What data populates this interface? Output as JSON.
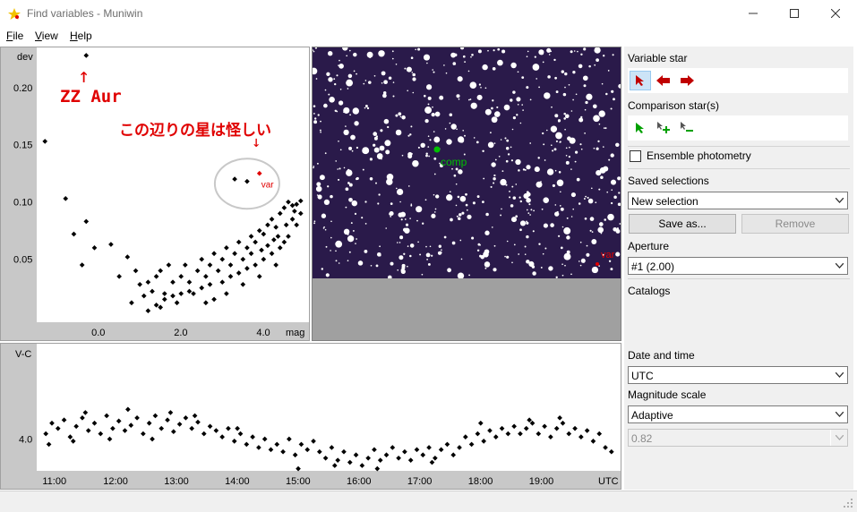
{
  "window": {
    "title": "Find variables - Muniwin"
  },
  "menu": {
    "file": {
      "accel": "F",
      "rest": "ile"
    },
    "view": {
      "accel": "V",
      "rest": "iew"
    },
    "help": {
      "accel": "H",
      "rest": "elp"
    }
  },
  "annotations": {
    "zz_arrow": "↑",
    "zz_aur": "ZZ Aur",
    "suspicious": "この辺りの星は怪しい",
    "down_arrow": "↓"
  },
  "image": {
    "comp_label": "comp",
    "var_label": "var"
  },
  "right_panel": {
    "variable_star": "Variable star",
    "comparison_stars": "Comparison star(s)",
    "ensemble": "Ensemble photometry",
    "saved_selections": "Saved selections",
    "selection_value": "New selection",
    "save_as": "Save as...",
    "remove": "Remove",
    "aperture": "Aperture",
    "aperture_value": "#1 (2.00)",
    "catalogs": "Catalogs",
    "date_time": "Date and time",
    "date_time_value": "UTC",
    "mag_scale": "Magnitude scale",
    "mag_scale_value": "Adaptive",
    "mag_range_value": "0.82"
  },
  "colors": {
    "accent": "#cce4f7",
    "annotation": "#e00000",
    "var_marker": "#e00000",
    "comp_marker": "#00c000",
    "starfield": "#2a1a4a"
  },
  "chart_data": [
    {
      "type": "scatter",
      "title": "",
      "xlabel": "mag",
      "ylabel": "dev",
      "xticks": [
        "0.0",
        "2.0",
        "4.0"
      ],
      "yticks": [
        "0.20",
        "0.15",
        "0.10",
        "0.05"
      ],
      "xlim": [
        -1.5,
        5.1
      ],
      "ylim": [
        -0.005,
        0.235
      ],
      "highlight": {
        "name": "var",
        "x": 3.9,
        "y": 0.125
      },
      "circle_annotation": {
        "cx": 3.6,
        "cy": 0.116
      },
      "points": [
        [
          -0.3,
          0.228
        ],
        [
          -1.3,
          0.153
        ],
        [
          -0.8,
          0.103
        ],
        [
          -0.3,
          0.083
        ],
        [
          -0.6,
          0.072
        ],
        [
          -0.1,
          0.06
        ],
        [
          0.3,
          0.063
        ],
        [
          0.7,
          0.052
        ],
        [
          -0.4,
          0.045
        ],
        [
          0.5,
          0.035
        ],
        [
          0.9,
          0.04
        ],
        [
          1.0,
          0.028
        ],
        [
          1.2,
          0.03
        ],
        [
          1.4,
          0.035
        ],
        [
          1.5,
          0.04
        ],
        [
          1.6,
          0.02
        ],
        [
          1.7,
          0.045
        ],
        [
          1.8,
          0.03
        ],
        [
          1.9,
          0.012
        ],
        [
          2.0,
          0.035
        ],
        [
          2.1,
          0.045
        ],
        [
          2.2,
          0.03
        ],
        [
          2.3,
          0.02
        ],
        [
          2.4,
          0.04
        ],
        [
          2.5,
          0.05
        ],
        [
          2.6,
          0.035
        ],
        [
          2.7,
          0.045
        ],
        [
          2.8,
          0.055
        ],
        [
          2.9,
          0.04
        ],
        [
          3.0,
          0.05
        ],
        [
          3.1,
          0.06
        ],
        [
          3.2,
          0.045
        ],
        [
          3.3,
          0.055
        ],
        [
          3.4,
          0.065
        ],
        [
          3.5,
          0.05
        ],
        [
          3.6,
          0.06
        ],
        [
          3.7,
          0.07
        ],
        [
          3.8,
          0.065
        ],
        [
          3.9,
          0.075
        ],
        [
          4.0,
          0.072
        ],
        [
          4.1,
          0.08
        ],
        [
          4.2,
          0.085
        ],
        [
          4.3,
          0.078
        ],
        [
          4.4,
          0.09
        ],
        [
          4.5,
          0.095
        ],
        [
          4.6,
          0.1
        ],
        [
          4.7,
          0.097
        ],
        [
          4.8,
          0.098
        ],
        [
          4.9,
          0.101
        ],
        [
          1.1,
          0.018
        ],
        [
          1.3,
          0.022
        ],
        [
          1.6,
          0.015
        ],
        [
          1.8,
          0.018
        ],
        [
          2.0,
          0.02
        ],
        [
          2.2,
          0.022
        ],
        [
          2.5,
          0.025
        ],
        [
          2.7,
          0.028
        ],
        [
          3.0,
          0.03
        ],
        [
          3.2,
          0.035
        ],
        [
          3.4,
          0.038
        ],
        [
          3.6,
          0.042
        ],
        [
          3.8,
          0.045
        ],
        [
          4.0,
          0.05
        ],
        [
          4.2,
          0.055
        ],
        [
          4.4,
          0.06
        ],
        [
          4.6,
          0.07
        ],
        [
          4.8,
          0.08
        ],
        [
          1.2,
          0.005
        ],
        [
          1.5,
          0.008
        ],
        [
          2.8,
          0.015
        ],
        [
          3.1,
          0.02
        ],
        [
          3.5,
          0.028
        ],
        [
          3.9,
          0.035
        ],
        [
          4.3,
          0.045
        ],
        [
          4.5,
          0.065
        ],
        [
          4.7,
          0.085
        ],
        [
          4.9,
          0.09
        ],
        [
          3.3,
          0.12
        ],
        [
          3.6,
          0.118
        ],
        [
          0.8,
          0.012
        ],
        [
          1.4,
          0.01
        ],
        [
          2.6,
          0.012
        ],
        [
          3.7,
          0.055
        ],
        [
          4.1,
          0.062
        ],
        [
          4.35,
          0.07
        ],
        [
          4.55,
          0.08
        ],
        [
          4.75,
          0.092
        ],
        [
          4.25,
          0.067
        ],
        [
          3.95,
          0.058
        ]
      ]
    },
    {
      "type": "scatter",
      "title": "",
      "xlabel": "UTC",
      "ylabel": "V-C",
      "xticks": [
        "11:00",
        "12:00",
        "13:00",
        "14:00",
        "15:00",
        "16:00",
        "17:00",
        "18:00",
        "19:00"
      ],
      "yticks": [
        "4.0"
      ],
      "xlim": [
        10.7,
        20.3
      ],
      "ylim": [
        3.1,
        4.3
      ],
      "points": [
        [
          10.85,
          3.95
        ],
        [
          10.95,
          3.85
        ],
        [
          11.05,
          3.9
        ],
        [
          11.15,
          3.82
        ],
        [
          11.25,
          3.98
        ],
        [
          11.35,
          3.88
        ],
        [
          11.45,
          3.8
        ],
        [
          11.55,
          3.92
        ],
        [
          11.65,
          3.85
        ],
        [
          11.75,
          3.95
        ],
        [
          11.85,
          3.78
        ],
        [
          11.95,
          3.9
        ],
        [
          12.05,
          3.83
        ],
        [
          12.15,
          3.92
        ],
        [
          12.25,
          3.87
        ],
        [
          12.35,
          3.8
        ],
        [
          12.45,
          3.95
        ],
        [
          12.55,
          3.85
        ],
        [
          12.65,
          3.78
        ],
        [
          12.75,
          3.9
        ],
        [
          12.85,
          3.82
        ],
        [
          12.95,
          3.93
        ],
        [
          13.05,
          3.86
        ],
        [
          13.15,
          3.8
        ],
        [
          13.25,
          3.9
        ],
        [
          13.35,
          3.84
        ],
        [
          13.45,
          3.95
        ],
        [
          13.55,
          3.88
        ],
        [
          13.65,
          3.92
        ],
        [
          13.75,
          3.98
        ],
        [
          13.85,
          3.9
        ],
        [
          13.95,
          4.02
        ],
        [
          14.05,
          3.95
        ],
        [
          14.15,
          4.05
        ],
        [
          14.25,
          3.98
        ],
        [
          14.35,
          4.08
        ],
        [
          14.45,
          4.0
        ],
        [
          14.55,
          4.1
        ],
        [
          14.65,
          4.05
        ],
        [
          14.75,
          4.12
        ],
        [
          14.85,
          4.0
        ],
        [
          14.95,
          4.15
        ],
        [
          15.05,
          4.05
        ],
        [
          15.15,
          4.1
        ],
        [
          15.25,
          4.02
        ],
        [
          15.35,
          4.12
        ],
        [
          15.45,
          4.18
        ],
        [
          15.55,
          4.08
        ],
        [
          15.65,
          4.2
        ],
        [
          15.75,
          4.12
        ],
        [
          15.85,
          4.22
        ],
        [
          15.95,
          4.15
        ],
        [
          16.05,
          4.25
        ],
        [
          16.15,
          4.18
        ],
        [
          16.25,
          4.1
        ],
        [
          16.35,
          4.2
        ],
        [
          16.45,
          4.15
        ],
        [
          16.55,
          4.08
        ],
        [
          16.65,
          4.18
        ],
        [
          16.75,
          4.12
        ],
        [
          16.85,
          4.2
        ],
        [
          16.95,
          4.1
        ],
        [
          17.05,
          4.15
        ],
        [
          17.15,
          4.08
        ],
        [
          17.25,
          4.18
        ],
        [
          17.35,
          4.1
        ],
        [
          17.45,
          4.05
        ],
        [
          17.55,
          4.15
        ],
        [
          17.65,
          4.08
        ],
        [
          17.75,
          3.98
        ],
        [
          17.85,
          4.05
        ],
        [
          17.95,
          3.95
        ],
        [
          18.05,
          4.02
        ],
        [
          18.15,
          3.92
        ],
        [
          18.25,
          3.98
        ],
        [
          18.35,
          3.9
        ],
        [
          18.45,
          3.95
        ],
        [
          18.55,
          3.88
        ],
        [
          18.65,
          3.95
        ],
        [
          18.75,
          3.9
        ],
        [
          18.85,
          3.85
        ],
        [
          18.95,
          3.95
        ],
        [
          19.05,
          3.88
        ],
        [
          19.15,
          3.98
        ],
        [
          19.25,
          3.9
        ],
        [
          19.35,
          3.85
        ],
        [
          19.45,
          3.95
        ],
        [
          19.55,
          3.9
        ],
        [
          19.65,
          3.98
        ],
        [
          19.75,
          3.92
        ],
        [
          19.85,
          4.02
        ],
        [
          19.95,
          3.95
        ],
        [
          20.05,
          4.08
        ],
        [
          20.15,
          4.12
        ],
        [
          11.5,
          3.75
        ],
        [
          12.2,
          3.72
        ],
        [
          12.9,
          3.75
        ],
        [
          13.3,
          3.78
        ],
        [
          14.0,
          3.9
        ],
        [
          15.0,
          4.28
        ],
        [
          15.6,
          4.25
        ],
        [
          16.3,
          4.28
        ],
        [
          17.2,
          4.22
        ],
        [
          18.0,
          3.85
        ],
        [
          18.8,
          3.82
        ],
        [
          19.3,
          3.8
        ],
        [
          10.9,
          4.05
        ],
        [
          11.3,
          4.02
        ],
        [
          11.9,
          4.0
        ],
        [
          12.6,
          4.0
        ]
      ]
    }
  ]
}
